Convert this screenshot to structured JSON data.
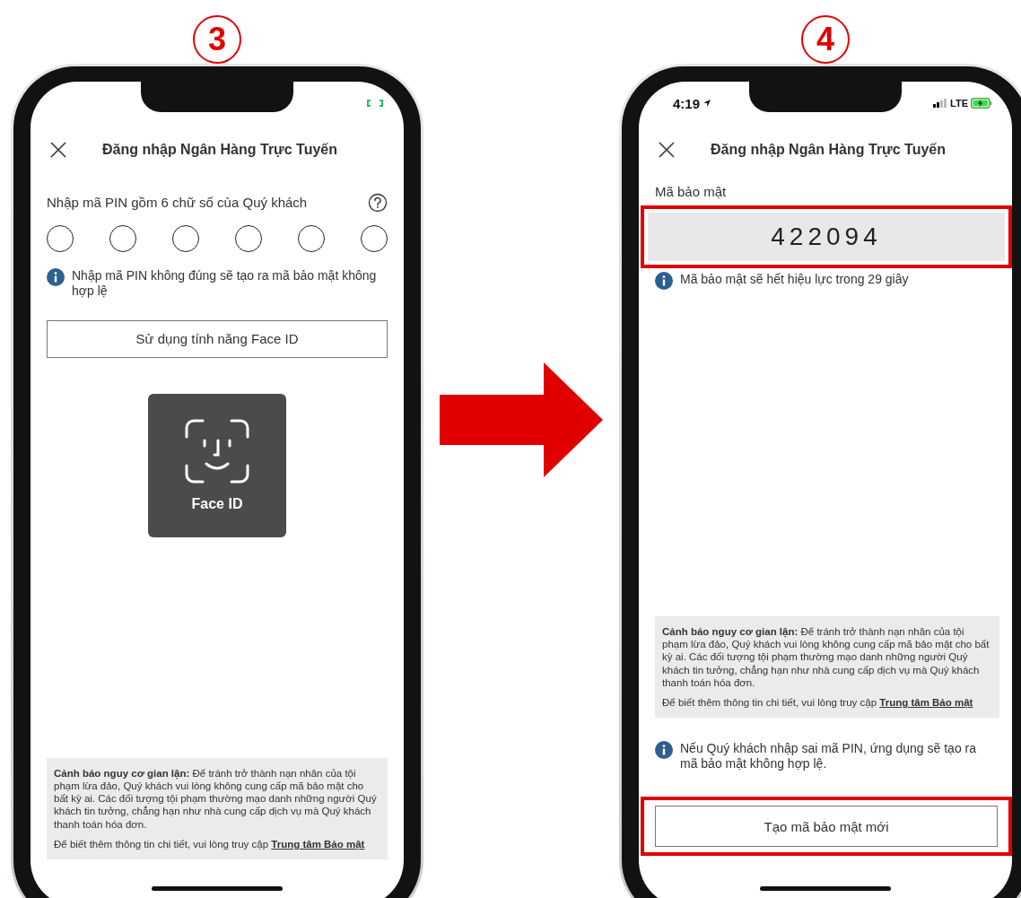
{
  "left_phone": {
    "step": "3",
    "header": {
      "title": "Đăng nhập Ngân Hàng Trực Tuyến"
    },
    "pin_prompt": "Nhập mã PIN gồm 6 chữ số của Quý khách",
    "pin_slots": [
      {
        "filled": false
      },
      {
        "filled": false
      },
      {
        "filled": false
      },
      {
        "filled": false
      },
      {
        "filled": false
      },
      {
        "filled": false
      }
    ],
    "info_note": "Nhập mã PIN không đúng sẽ tạo ra mã bảo mật không hợp lệ",
    "face_id_button": "Sử dụng tính năng Face ID",
    "face_id_tile": "Face ID",
    "warning": {
      "text": "**Cảnh báo nguy cơ gian lận:** Để tránh trở thành nạn nhân của tội phạm lừa đảo, Quý khách vui lòng không cung cấp mã bảo mật cho bất kỳ ai. Các đối tượng tội phạm thường mạo danh những người Quý khách tin tưởng, chẳng hạn như nhà cung cấp dịch vụ mà Quý khách thanh toán hóa đơn.",
      "more_text": "Để biết thêm thông tin chi tiết, vui lòng truy cập",
      "link": "Trung tâm Bảo mật"
    }
  },
  "right_phone": {
    "step": "4",
    "status_bar": {
      "time": "4:19",
      "network": "LTE"
    },
    "header": {
      "title": "Đăng nhập Ngân Hàng Trực Tuyến"
    },
    "code_label": "Mã bảo mật",
    "code": "422094",
    "code_highlighted": true,
    "expiry_note": "Mã bảo mật sẽ hết hiệu lực trong 29 giây",
    "warning": {
      "text": "**Cảnh báo nguy cơ gian lận:** Để tránh trở thành nạn nhân của tội phạm lừa đảo, Quý khách vui lòng không cung cấp mã bảo mật cho bất kỳ ai. Các đối tượng tội phạm thường mạo danh những người Quý khách tin tưởng, chẳng hạn như nhà cung cấp dịch vụ mà Quý khách thanh toán hóa đơn.",
      "more_text": "Để biết thêm thông tin chi tiết, vui lòng truy cập",
      "link": "Trung tâm Bảo mật"
    },
    "pin_note": "Nếu Quý khách nhập sai mã PIN, ứng dụng sẽ tạo ra mã bảo mật không hợp lệ.",
    "new_code_button": "Tạo mã bảo mật mới",
    "button_highlighted": true
  }
}
